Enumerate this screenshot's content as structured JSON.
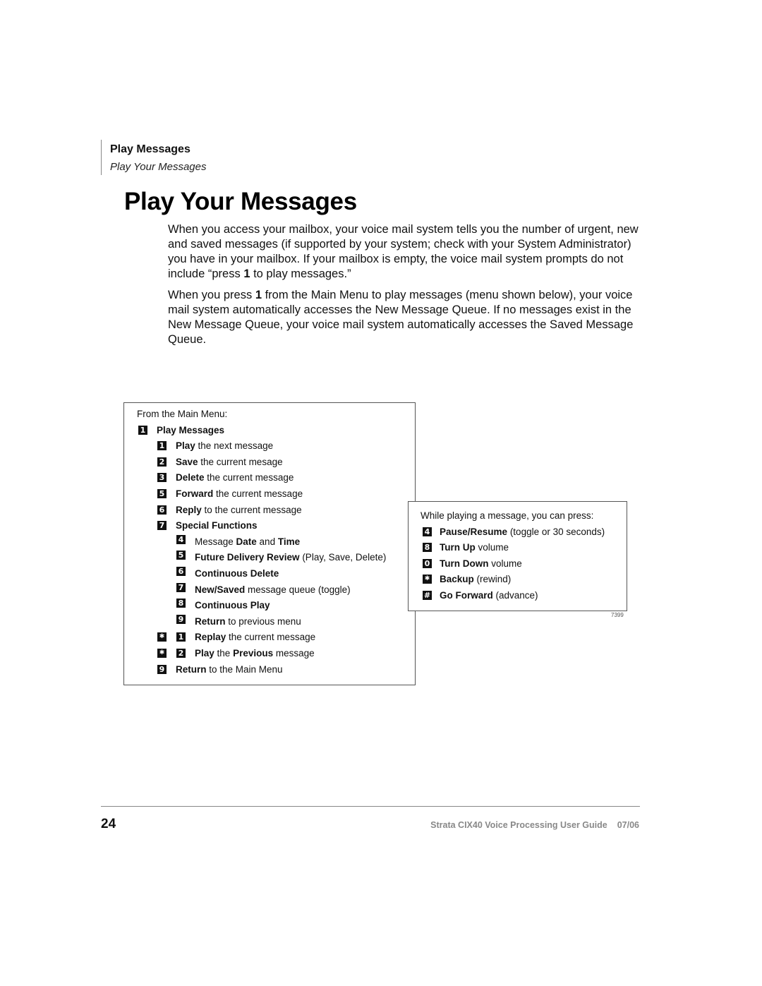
{
  "header": {
    "section": "Play Messages",
    "subsection": "Play Your Messages"
  },
  "title": "Play Your Messages",
  "paragraphs": {
    "p1": {
      "before": "When you access your mailbox, your voice mail system tells you the number of urgent, new and saved messages (if supported by your system; check with your System Administrator) you have in your mailbox. If your mailbox is empty, the voice mail system prompts do not include “press ",
      "bold": "1",
      "after": " to play messages.”"
    },
    "p2": {
      "before": "When you press ",
      "bold": "1",
      "after": " from the Main Menu to play messages (menu shown below), your voice mail system automatically accesses the New Message Queue. If no messages exist in the New Message Queue, your voice mail system automatically accesses the Saved Message Queue."
    }
  },
  "main_menu_box": {
    "caption": "From the Main Menu:",
    "items": [
      {
        "keys": [
          "1"
        ],
        "bold": "Play Messages",
        "rest": "",
        "level": 0
      },
      {
        "keys": [
          "1"
        ],
        "bold": "Play",
        "rest": " the next message",
        "level": 1
      },
      {
        "keys": [
          "2"
        ],
        "bold": "Save",
        "rest": " the current mesage",
        "level": 1
      },
      {
        "keys": [
          "3"
        ],
        "bold": "Delete",
        "rest": " the current message",
        "level": 1
      },
      {
        "keys": [
          "5"
        ],
        "bold": "Forward",
        "rest": " the current message",
        "level": 1
      },
      {
        "keys": [
          "6"
        ],
        "bold": "Reply",
        "rest": " to the current message",
        "level": 1
      },
      {
        "keys": [
          "7"
        ],
        "bold": "Special Functions",
        "rest": "",
        "level": 1
      },
      {
        "keys": [
          "4"
        ],
        "pre": "Message ",
        "bold": "Date",
        "mid": " and ",
        "bold2": "Time",
        "rest": "",
        "level": 2
      },
      {
        "keys": [
          "5"
        ],
        "bold": "Future Delivery Review",
        "rest": " (Play, Save, Delete)",
        "level": 2
      },
      {
        "keys": [
          "6"
        ],
        "bold": "Continuous Delete",
        "rest": "",
        "level": 2
      },
      {
        "keys": [
          "7"
        ],
        "bold": "New/Saved",
        "rest": " message queue (toggle)",
        "level": 2
      },
      {
        "keys": [
          "8"
        ],
        "bold": "Continuous Play",
        "rest": "",
        "level": 2
      },
      {
        "keys": [
          "9"
        ],
        "bold": "Return",
        "rest": " to previous menu",
        "level": 2
      },
      {
        "keys": [
          "*",
          "1"
        ],
        "bold": "Replay",
        "rest": " the current message",
        "level": 1
      },
      {
        "keys": [
          "*",
          "2"
        ],
        "bold": "Play",
        "mid": " the ",
        "bold2": "Previous",
        "rest": " message",
        "level": 1
      },
      {
        "keys": [
          "9"
        ],
        "bold": "Return",
        "rest": " to the Main Menu",
        "level": 1
      }
    ]
  },
  "playback_box": {
    "caption": "While playing a message, you can press:",
    "items": [
      {
        "keys": [
          "4"
        ],
        "bold": "Pause/Resume",
        "rest": " (toggle or 30 seconds)"
      },
      {
        "keys": [
          "8"
        ],
        "bold": "Turn Up",
        "rest": " volume"
      },
      {
        "keys": [
          "0"
        ],
        "bold": "Turn Down",
        "rest": " volume"
      },
      {
        "keys": [
          "*"
        ],
        "bold": "Backup",
        "rest": " (rewind)"
      },
      {
        "keys": [
          "#"
        ],
        "bold": "Go Forward",
        "rest": " (advance)"
      }
    ],
    "figure_number": "7399"
  },
  "footer": {
    "page_number": "24",
    "guide_title": "Strata CIX40 Voice Processing User Guide",
    "date": "07/06"
  }
}
